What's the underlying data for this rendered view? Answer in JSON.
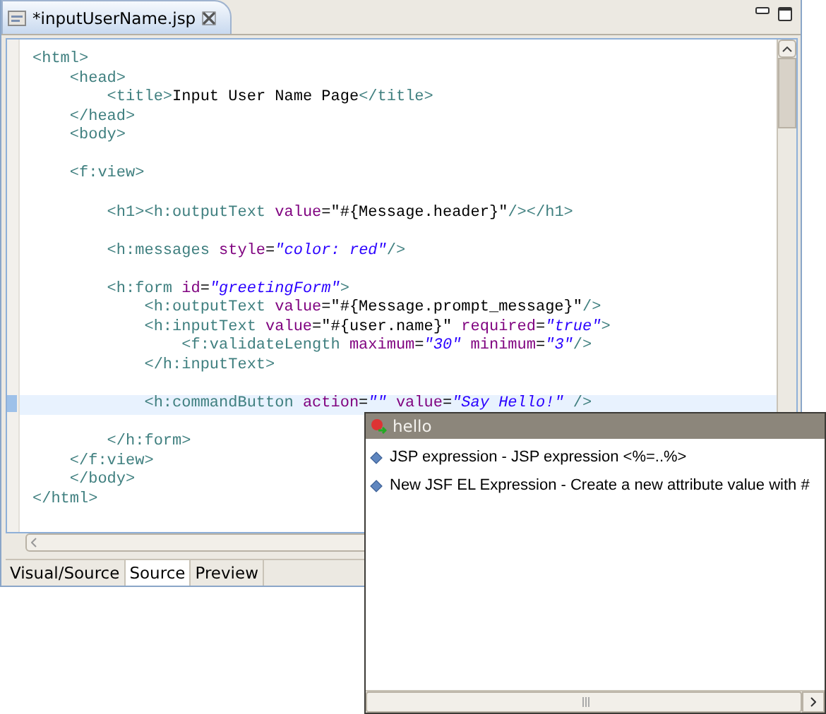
{
  "editor_tab": {
    "title": "*inputUserName.jsp"
  },
  "code_lines": [
    {
      "kind": "code",
      "current": false,
      "tokens": [
        {
          "kind": "tag",
          "text": "<html>"
        }
      ]
    },
    {
      "kind": "code",
      "current": false,
      "tokens": [
        {
          "kind": "tag",
          "text": "    <head>"
        }
      ]
    },
    {
      "kind": "code",
      "current": false,
      "tokens": [
        {
          "kind": "tag",
          "text": "        <title>"
        },
        {
          "kind": "text",
          "text": "Input User Name Page"
        },
        {
          "kind": "tag",
          "text": "</title>"
        }
      ]
    },
    {
      "kind": "code",
      "current": false,
      "tokens": [
        {
          "kind": "tag",
          "text": "    </head>"
        }
      ]
    },
    {
      "kind": "code",
      "current": false,
      "tokens": [
        {
          "kind": "tag",
          "text": "    <body>"
        }
      ]
    },
    {
      "kind": "blank"
    },
    {
      "kind": "code",
      "current": false,
      "tokens": [
        {
          "kind": "tag",
          "text": "    <f:view>"
        }
      ]
    },
    {
      "kind": "blank"
    },
    {
      "kind": "code",
      "current": false,
      "tokens": [
        {
          "kind": "tag",
          "text": "        <h1><h:outputText "
        },
        {
          "kind": "attr",
          "text": "value"
        },
        {
          "kind": "text",
          "text": "=\"#{Message.header}\""
        },
        {
          "kind": "tag",
          "text": "/></h1>"
        }
      ]
    },
    {
      "kind": "blank"
    },
    {
      "kind": "code",
      "current": false,
      "tokens": [
        {
          "kind": "tag",
          "text": "        <h:messages "
        },
        {
          "kind": "attr",
          "text": "style"
        },
        {
          "kind": "text",
          "text": "="
        },
        {
          "kind": "value",
          "text": "\"color: red\""
        },
        {
          "kind": "tag",
          "text": "/>"
        }
      ]
    },
    {
      "kind": "blank"
    },
    {
      "kind": "code",
      "current": false,
      "tokens": [
        {
          "kind": "tag",
          "text": "        <h:form "
        },
        {
          "kind": "attr",
          "text": "id"
        },
        {
          "kind": "text",
          "text": "="
        },
        {
          "kind": "value",
          "text": "\"greetingForm\""
        },
        {
          "kind": "tag",
          "text": ">"
        }
      ]
    },
    {
      "kind": "code",
      "current": false,
      "tokens": [
        {
          "kind": "tag",
          "text": "            <h:outputText "
        },
        {
          "kind": "attr",
          "text": "value"
        },
        {
          "kind": "text",
          "text": "=\"#{Message.prompt_message}\""
        },
        {
          "kind": "tag",
          "text": "/>"
        }
      ]
    },
    {
      "kind": "code",
      "current": false,
      "tokens": [
        {
          "kind": "tag",
          "text": "            <h:inputText "
        },
        {
          "kind": "attr",
          "text": "value"
        },
        {
          "kind": "text",
          "text": "=\"#{user.name}\""
        },
        {
          "kind": "attr",
          "text": " required"
        },
        {
          "kind": "text",
          "text": "="
        },
        {
          "kind": "value",
          "text": "\"true\""
        },
        {
          "kind": "tag",
          "text": ">"
        }
      ]
    },
    {
      "kind": "code",
      "current": false,
      "tokens": [
        {
          "kind": "tag",
          "text": "                <f:validateLength "
        },
        {
          "kind": "attr",
          "text": "maximum"
        },
        {
          "kind": "text",
          "text": "="
        },
        {
          "kind": "value",
          "text": "\"30\""
        },
        {
          "kind": "attr",
          "text": " minimum"
        },
        {
          "kind": "text",
          "text": "="
        },
        {
          "kind": "value",
          "text": "\"3\""
        },
        {
          "kind": "tag",
          "text": "/>"
        }
      ]
    },
    {
      "kind": "code",
      "current": false,
      "tokens": [
        {
          "kind": "tag",
          "text": "            </h:inputText>"
        }
      ]
    },
    {
      "kind": "blank"
    },
    {
      "kind": "code",
      "current": true,
      "tokens": [
        {
          "kind": "tag",
          "text": "            <h:commandButton "
        },
        {
          "kind": "attr",
          "text": "action"
        },
        {
          "kind": "text",
          "text": "="
        },
        {
          "kind": "value",
          "text": "\"\""
        },
        {
          "kind": "attr",
          "text": " value"
        },
        {
          "kind": "text",
          "text": "="
        },
        {
          "kind": "value",
          "text": "\"Say Hello!\""
        },
        {
          "kind": "tag",
          "text": " />"
        }
      ]
    },
    {
      "kind": "blank"
    },
    {
      "kind": "code",
      "current": false,
      "tokens": [
        {
          "kind": "tag",
          "text": "        </h:form>"
        }
      ]
    },
    {
      "kind": "code",
      "current": false,
      "tokens": [
        {
          "kind": "tag",
          "text": "    </f:view>"
        }
      ]
    },
    {
      "kind": "code",
      "current": false,
      "tokens": [
        {
          "kind": "tag",
          "text": "    </body>"
        }
      ]
    },
    {
      "kind": "code",
      "current": false,
      "tokens": [
        {
          "kind": "tag",
          "text": "</html>"
        }
      ]
    }
  ],
  "bottom_tabs": [
    {
      "label": "Visual/Source",
      "selected": false
    },
    {
      "label": "Source",
      "selected": true
    },
    {
      "label": "Preview",
      "selected": false
    }
  ],
  "popup": {
    "title": "hello",
    "items": [
      {
        "text": "JSP expression - JSP expression <%=..%>"
      },
      {
        "text": "New JSF EL Expression - Create a new attribute value with #"
      }
    ]
  }
}
